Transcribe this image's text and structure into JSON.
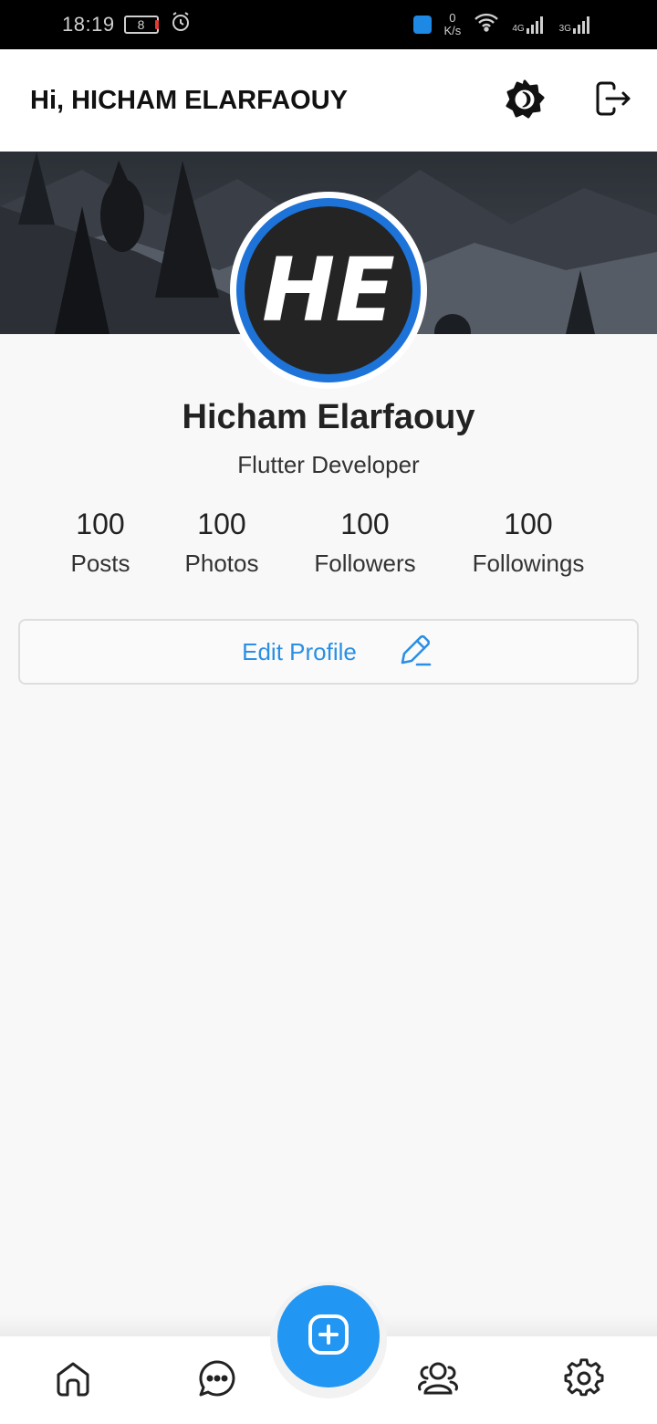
{
  "status_bar": {
    "time": "18:19",
    "battery": "8",
    "speed_value": "0",
    "speed_unit": "K/s",
    "network_1": "4G",
    "network_2": "3G"
  },
  "header": {
    "greeting": "Hi, HICHAM ELARFAOUY",
    "theme_icon": "brightness-icon",
    "logout_icon": "logout-icon"
  },
  "profile": {
    "avatar_text": "HE",
    "name": "Hicham Elarfaouy",
    "role": "Flutter Developer",
    "accent": "#1e73d8"
  },
  "stats": [
    {
      "value": "100",
      "label": "Posts"
    },
    {
      "value": "100",
      "label": "Photos"
    },
    {
      "value": "100",
      "label": "Followers"
    },
    {
      "value": "100",
      "label": "Followings"
    }
  ],
  "edit_button": {
    "label": "Edit Profile",
    "icon": "pencil-icon",
    "color": "#2b8fe4"
  },
  "bottom_nav": {
    "items": [
      "home-icon",
      "chat-icon",
      "add-post-icon",
      "users-icon",
      "settings-icon"
    ],
    "fab_color": "#2196f3"
  }
}
